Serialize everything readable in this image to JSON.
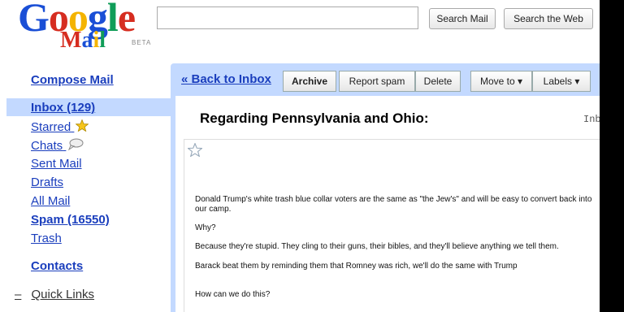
{
  "logo": {
    "word": "Google",
    "sub": "Mail",
    "beta": "BETA"
  },
  "search": {
    "mail_label": "Search Mail",
    "web_label": "Search the Web"
  },
  "sidebar": {
    "compose": "Compose Mail",
    "items": [
      {
        "label": "Inbox (129)"
      },
      {
        "label": "Starred"
      },
      {
        "label": "Chats"
      },
      {
        "label": "Sent Mail"
      },
      {
        "label": "Drafts"
      },
      {
        "label": "All Mail"
      },
      {
        "label": "Spam (16550)"
      },
      {
        "label": "Trash"
      }
    ],
    "contacts": "Contacts",
    "quick_links": "Quick Links"
  },
  "toolbar": {
    "back": "« Back to Inbox",
    "archive": "Archive",
    "report_spam": "Report spam",
    "delete": "Delete",
    "move_to": "Move to ▾",
    "labels": "Labels ▾"
  },
  "message": {
    "subject": "Regarding Pennsylvania and Ohio:",
    "label_tag": "Inb",
    "lines": [
      "Donald Trump's white trash blue collar voters are the same as \"the Jew's\" and will be easy to convert back into our camp.",
      "Why?",
      "Because they're stupid. They cling to their guns, their bibles, and they'll believe anything we tell them.",
      "Barack beat them by reminding them that Romney was rich, we'll do the same with Trump",
      "How can we do this?"
    ]
  },
  "colors": {
    "link": "#1a3ebd",
    "panel": "#c3d9ff"
  }
}
